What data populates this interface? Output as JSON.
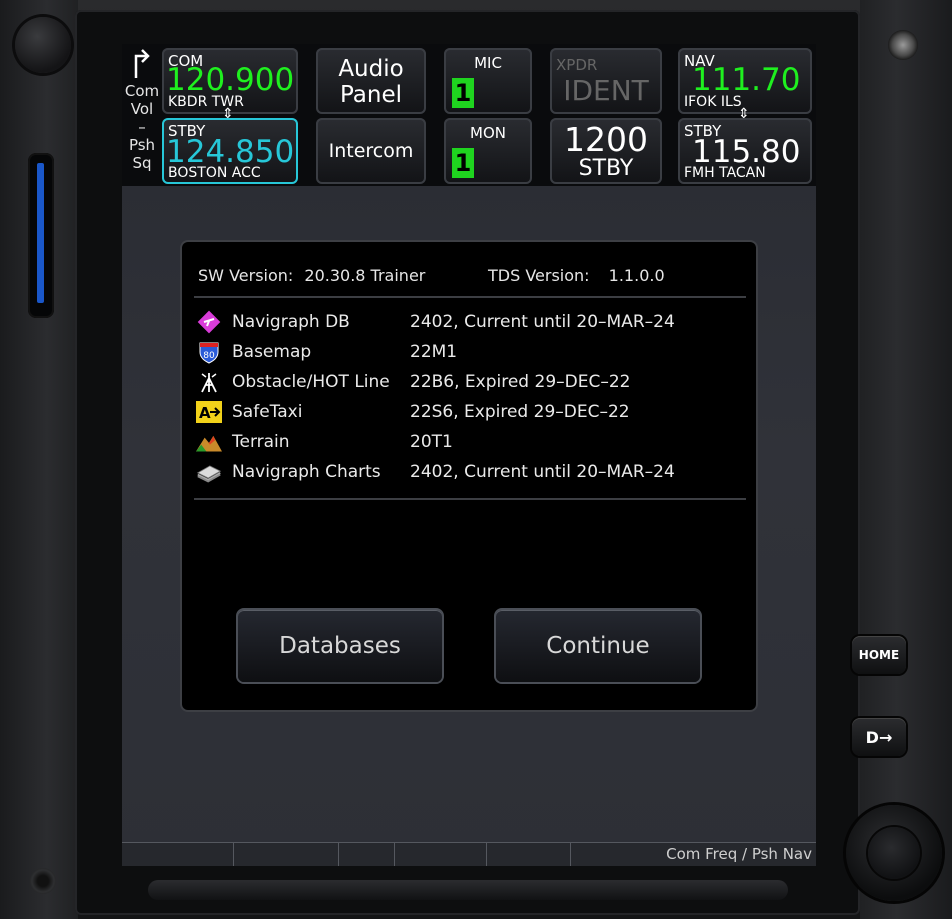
{
  "com": {
    "label": "COM",
    "active_freq": "120.900",
    "active_station": "KBDR TWR",
    "stby_label": "STBY",
    "stby_freq": "124.850",
    "stby_station": "BOSTON ACC"
  },
  "left_hint": {
    "line1": "Com",
    "line2": "Vol",
    "line3": "–",
    "line4": "Psh",
    "line5": "Sq"
  },
  "audio": {
    "panel_line1": "Audio",
    "panel_line2": "Panel",
    "intercom": "Intercom"
  },
  "mic": {
    "label": "MIC",
    "value": "1"
  },
  "mon": {
    "label": "MON",
    "value": "1"
  },
  "xpdr": {
    "label": "XPDR",
    "ident": "IDENT",
    "code": "1200",
    "mode": "STBY"
  },
  "nav": {
    "label": "NAV",
    "active_freq": "111.70",
    "active_station": "IFOK ILS",
    "stby_label": "STBY",
    "stby_freq": "115.80",
    "stby_station": "FMH TACAN"
  },
  "dialog": {
    "sw_label": "SW Version:",
    "sw_value": "20.30.8 Trainer",
    "tds_label": "TDS Version:",
    "tds_value": "1.1.0.0",
    "databases": [
      {
        "icon": "navigraph-db-icon",
        "name": "Navigraph DB",
        "status": "2402, Current until 20–MAR–24"
      },
      {
        "icon": "basemap-icon",
        "name": "Basemap",
        "status": "22M1"
      },
      {
        "icon": "obstacle-icon",
        "name": "Obstacle/HOT Line",
        "status": "22B6, Expired 29–DEC–22"
      },
      {
        "icon": "safetaxi-icon",
        "name": "SafeTaxi",
        "status": "22S6, Expired 29–DEC–22"
      },
      {
        "icon": "terrain-icon",
        "name": "Terrain",
        "status": "20T1"
      },
      {
        "icon": "charts-icon",
        "name": "Navigraph Charts",
        "status": "2402, Current until 20–MAR–24"
      }
    ],
    "basemap_badge": "80",
    "safetaxi_badge": "A",
    "databases_button": "Databases",
    "continue_button": "Continue"
  },
  "bottom_hint": "Com Freq / Psh Nav",
  "side_buttons": {
    "home": "HOME",
    "direct_to": "D→"
  },
  "colors": {
    "green": "#1ff01f",
    "cyan_border": "#27c7d8",
    "dialog_bg": "#000000"
  }
}
